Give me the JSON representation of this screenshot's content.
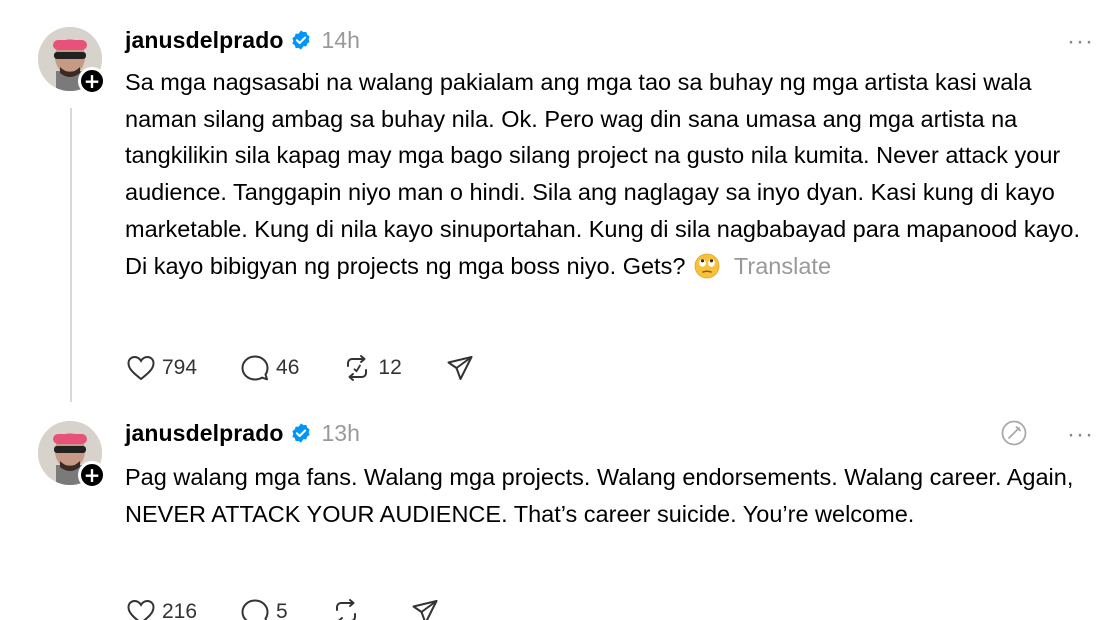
{
  "posts": [
    {
      "username": "janusdelprado",
      "time": "14h",
      "more_label": "···",
      "text": "Sa mga nagsasabi na walang pakialam ang mga tao sa buhay ng mga artista kasi wala naman silang ambag sa buhay nila. Ok. Pero wag din sana umasa ang mga artista na tangkilikin sila kapag may mga bago silang project na gusto nila kumita. Never attack your audience. Tanggapin niyo man o hindi. Sila ang naglagay sa inyo dyan. Kasi kung di kayo marketable. Kung di nila kayo sinuportahan. Kung di sila nagbabayad para mapanood kayo. Di kayo bibigyan ng projects ng mga boss niyo. Gets?",
      "translate": "Translate",
      "likes": "794",
      "replies": "46",
      "reposts": "12"
    },
    {
      "username": "janusdelprado",
      "time": "13h",
      "more_label": "···",
      "text": "Pag walang mga fans. Walang mga projects. Walang endorsements. Walang career. Again, NEVER ATTACK YOUR AUDIENCE. That’s career suicide. You’re welcome.",
      "likes": "216",
      "replies": "5",
      "reposts": ""
    }
  ],
  "icons": {
    "like": "heart-icon",
    "reply": "comment-icon",
    "repost": "repost-icon",
    "share": "send-icon",
    "verified": "verified-badge-icon",
    "emoji": "face-with-rolling-eyes-emoji",
    "edited": "edited-icon"
  },
  "colors": {
    "verified": "#0095f6",
    "muted": "#999999",
    "thread_line": "#d9d9d9"
  }
}
